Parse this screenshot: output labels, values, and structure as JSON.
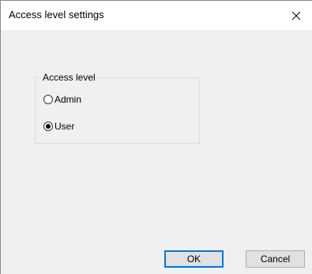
{
  "window": {
    "title": "Access level settings"
  },
  "titlebar": {
    "close_icon": "close-x-icon"
  },
  "access_group": {
    "legend": "Access level",
    "options": [
      {
        "label": "Admin",
        "checked": false
      },
      {
        "label": "User",
        "checked": true
      }
    ]
  },
  "buttons": {
    "ok_label": "OK",
    "cancel_label": "Cancel"
  },
  "colors": {
    "dialog_background": "#f0f0f0",
    "titlebar_background": "#ffffff",
    "default_button_accent": "#0078d7"
  }
}
